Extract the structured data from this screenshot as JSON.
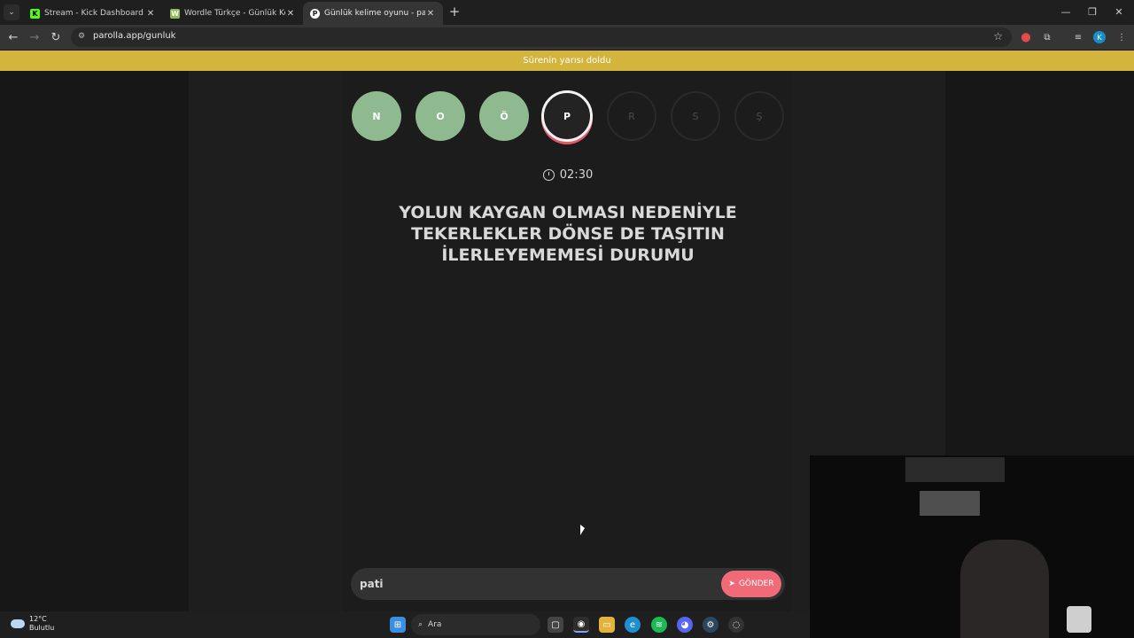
{
  "browser": {
    "tabs": [
      {
        "title": "Stream - Kick Dashboard",
        "favicon": "K",
        "color": "#53fc18"
      },
      {
        "title": "Wordle Türkçe - Günlük Kelime",
        "favicon": "W",
        "color": "#8dbd52"
      },
      {
        "title": "Günlük kelime oyunu - parolla",
        "favicon": "P",
        "color": "#ffffff"
      }
    ],
    "url": "parolla.app/gunluk"
  },
  "banner": {
    "text": "Sürenin yarısı doldu"
  },
  "game": {
    "letters": [
      {
        "letter": "N",
        "state": "done"
      },
      {
        "letter": "O",
        "state": "done"
      },
      {
        "letter": "Ö",
        "state": "done"
      },
      {
        "letter": "P",
        "state": "current"
      },
      {
        "letter": "R",
        "state": "pending"
      },
      {
        "letter": "S",
        "state": "pending"
      },
      {
        "letter": "Ş",
        "state": "pending"
      }
    ],
    "timer": "02:30",
    "question": "YOLUN KAYGAN OLMASI NEDENİYLE TEKERLEKLER DÖNSE DE TAŞITIN İLERLEYEMEMESİ DURUMU",
    "answer_value": "pati",
    "send_label": "GÖNDER"
  },
  "taskbar": {
    "temperature": "12°C",
    "condition": "Bulutlu",
    "search_label": "Ara"
  },
  "colors": {
    "accent": "#f06a78",
    "done": "#8fba8f",
    "banner": "#d3b53d"
  }
}
